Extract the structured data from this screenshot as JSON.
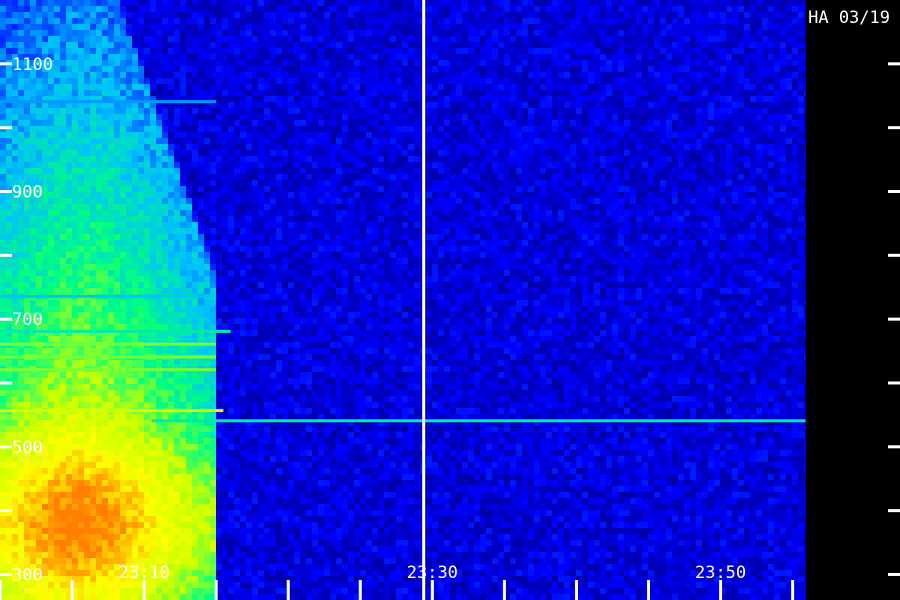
{
  "chart_data": {
    "type": "heatmap",
    "station_label": "HA 03/19",
    "x_axis": {
      "unit": "UT",
      "range": [
        "23:00",
        "23:56"
      ],
      "tick_labels": [
        "23:10",
        "23:30",
        "23:50"
      ],
      "tick_values_min": [
        10,
        30,
        50
      ],
      "minor_tick_step_min": 5
    },
    "y_axis": {
      "range": [
        260,
        1200
      ],
      "tick_labels": [
        "300",
        "500",
        "700",
        "900",
        "1100"
      ],
      "tick_values": [
        300,
        500,
        700,
        900,
        1100
      ],
      "minor_tick_step": 100
    },
    "data_end_time": "23:55.9",
    "marker_line_time": "23:29.4",
    "colormap": [
      "#000080",
      "#0000ff",
      "#00bfff",
      "#00ff80",
      "#c8ff00",
      "#ffff00",
      "#ff8000"
    ],
    "background_level": 0.12,
    "emission": {
      "start_time": "23:00",
      "end_time": "23:15",
      "peak_time": "23:05.5",
      "peak_freq": 380,
      "max_freq": 1160
    },
    "interference_bands": [
      {
        "freq": 540,
        "start_time": "23:10.5",
        "end_time": "23:55.9",
        "level": 0.45
      },
      {
        "freq": 556,
        "start_time": "23:00",
        "end_time": "23:15.5",
        "level": 0.7
      },
      {
        "freq": 620,
        "start_time": "23:00",
        "end_time": "23:15",
        "level": 0.6
      },
      {
        "freq": 640,
        "start_time": "23:00",
        "end_time": "23:15",
        "level": 0.6
      },
      {
        "freq": 660,
        "start_time": "23:00",
        "end_time": "23:15",
        "level": 0.6
      },
      {
        "freq": 680,
        "start_time": "23:00",
        "end_time": "23:16",
        "level": 0.45
      },
      {
        "freq": 735,
        "start_time": "23:00",
        "end_time": "23:15",
        "level": 0.35
      },
      {
        "freq": 1040,
        "start_time": "23:00",
        "end_time": "23:15",
        "level": 0.3
      }
    ]
  }
}
